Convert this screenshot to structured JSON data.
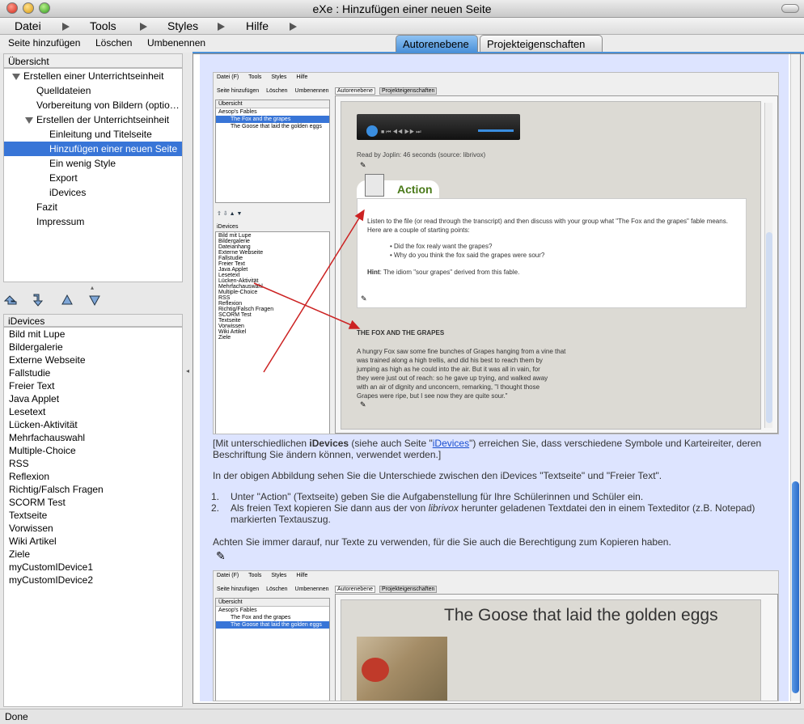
{
  "window": {
    "title": "eXe : Hinzufügen einer neuen Seite"
  },
  "menu": [
    "Datei",
    "Tools",
    "Styles",
    "Hilfe"
  ],
  "actions": [
    "Seite hinzufügen",
    "Löschen",
    "Umbenennen"
  ],
  "tabs": [
    "Autorenebene",
    "Projekteigenschaften"
  ],
  "outline": {
    "header": "Übersicht",
    "items": [
      "Erstellen einer Unterrichtseinheit",
      "Quelldateien",
      "Vorbereitung von Bildern (optio…",
      "Erstellen der Unterrichtseinheit",
      "Einleitung und Titelseite",
      "Hinzufügen einer neuen Seite",
      "Ein wenig Style",
      "Export",
      "iDevices",
      "Fazit",
      "Impressum"
    ]
  },
  "idevices": {
    "header": "iDevices",
    "items": [
      "Bild mit Lupe",
      "Bildergalerie",
      "Externe Webseite",
      "Fallstudie",
      "Freier Text",
      "Java Applet",
      "Lesetext",
      "Lücken-Aktivität",
      "Mehrfachauswahl",
      "Multiple-Choice",
      "RSS",
      "Reflexion",
      "Richtig/Falsch Fragen",
      "SCORM Test",
      "Textseite",
      "Vorwissen",
      "Wiki Artikel",
      "Ziele",
      "myCustomIDevice1",
      "myCustomIDevice2"
    ]
  },
  "screenshot1": {
    "menu": [
      "Datei (F)",
      "Tools",
      "Styles",
      "Hilfe"
    ],
    "actions": [
      "Seite hinzufügen",
      "Löschen",
      "Umbenennen"
    ],
    "tabs": [
      "Autorenebene",
      "Projekteigenschaften"
    ],
    "tree": [
      "Übersicht",
      "Aesop's Fables",
      "The Fox and the grapes",
      "The Goose that laid the golden eggs"
    ],
    "idevices_header": "iDevices",
    "idevices": [
      "Bild mit Lupe",
      "Bildergalerie",
      "Dateianhang",
      "Externe Webseite",
      "Fallstudie",
      "Freier Text",
      "Java Applet",
      "Lesetext",
      "Lücken-Aktivität",
      "Mehrfachauswahl",
      "Multiple-Choice",
      "RSS",
      "Reflexion",
      "Richtig/Falsch Fragen",
      "SCORM Test",
      "Textseite",
      "Vorwissen",
      "Wiki Artikel",
      "Ziele"
    ],
    "read_by": "Read by Joplin: 46 seconds (source: librivox)",
    "action_title": "Action",
    "action_text": "Listen to the file (or read through the transcript) and then discuss with your group what \"The Fox and the grapes\" fable means. Here are a couple of starting points:",
    "bullets": [
      "Did the fox realy want the grapes?",
      "Why do you think the fox said the grapes were sour?"
    ],
    "hint_label": "Hint",
    "hint_text": ": The idiom \"sour grapes\" derived from this fable.",
    "story_title": "THE FOX AND THE GRAPES",
    "story": [
      "A hungry Fox saw some fine bunches of Grapes hanging from a vine that",
      "was trained along a high trellis, and did his best to reach them by",
      "jumping as high as he could into the air. But it was all in vain, for",
      "they were just out of reach: so he gave up trying, and walked away",
      "with an air of dignity and unconcern, remarking, \"I thought those",
      "Grapes were ripe, but I see now they are quite sour.\""
    ]
  },
  "body": {
    "para1_a": "[Mit unterschiedlichen ",
    "para1_b": "iDevices",
    "para1_c": " (siehe auch Seite \"",
    "para1_link": "iDevices",
    "para1_d": "\") erreichen Sie, dass verschiedene Symbole und Karteireiter, deren Beschriftung Sie ändern können, verwendet werden.]",
    "para2": "In der obigen Abbildung sehen Sie die Unterschiede zwischen den iDevices \"Textseite\" und \"Freier Text\".",
    "list1": "Unter \"Action\" (Textseite) geben Sie die Aufgabenstellung für Ihre Schülerinnen und Schüler ein.",
    "list2_a": "Als freien Text kopieren Sie dann aus der von ",
    "list2_em": "librivox",
    "list2_b": " herunter geladenen Textdatei den in einem Texteditor (z.B. Notepad) markierten Textauszug.",
    "para3": "Achten Sie immer darauf, nur Texte zu verwenden, für die Sie auch die Berechtigung zum Kopieren haben."
  },
  "screenshot2": {
    "menu": [
      "Datei (F)",
      "Tools",
      "Styles",
      "Hilfe"
    ],
    "actions": [
      "Seite hinzufügen",
      "Löschen",
      "Umbenennen"
    ],
    "tabs": [
      "Autorenebene",
      "Projekteigenschaften"
    ],
    "tree": [
      "Übersicht",
      "Aesop's Fables",
      "The Fox and the grapes",
      "The Goose that laid the golden eggs"
    ],
    "heading": "The Goose that laid the golden eggs"
  },
  "status": "Done",
  "colors": {
    "accent": "#3875d7",
    "action_green": "#4a7a1a",
    "arrow_red": "#cc2222"
  }
}
